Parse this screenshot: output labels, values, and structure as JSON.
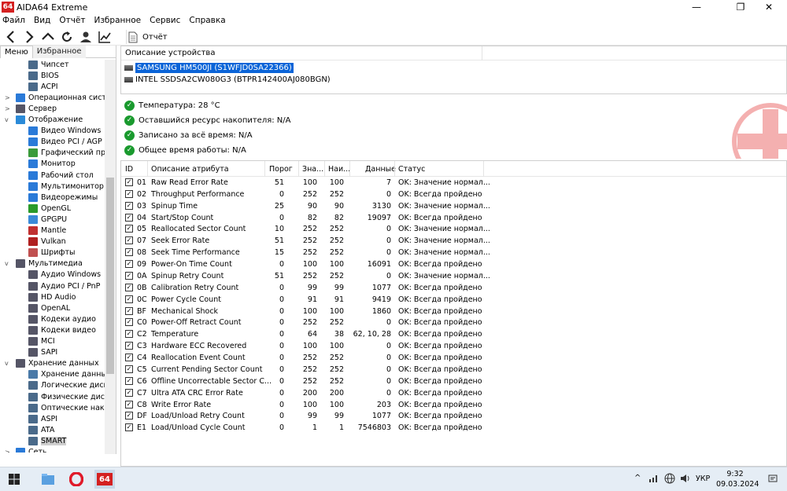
{
  "window": {
    "title": "AIDA64 Extreme",
    "app_badge": "64",
    "minimize": "—",
    "maximize": "❐",
    "close": "✕"
  },
  "menu": [
    "Файл",
    "Вид",
    "Отчёт",
    "Избранное",
    "Сервис",
    "Справка"
  ],
  "toolbar": {
    "report_label": "Отчёт"
  },
  "left_tabs": {
    "menu": "Меню",
    "favorites": "Избранное"
  },
  "tree": [
    {
      "label": "Чипсет",
      "level": 2,
      "color": "#4a6a8a"
    },
    {
      "label": "BIOS",
      "level": 2,
      "color": "#4a6a8a"
    },
    {
      "label": "ACPI",
      "level": 2,
      "color": "#4a6a8a"
    },
    {
      "label": "Операционная систем",
      "level": 1,
      "color": "#2a7ad8",
      "exp": ">"
    },
    {
      "label": "Сервер",
      "level": 1,
      "color": "#556",
      "exp": ">"
    },
    {
      "label": "Отображение",
      "level": 1,
      "color": "#2a8ad8",
      "exp": "v"
    },
    {
      "label": "Видео Windows",
      "level": 2,
      "color": "#2a7ad8"
    },
    {
      "label": "Видео PCI / AGP",
      "level": 2,
      "color": "#2a7ad8"
    },
    {
      "label": "Графический проц",
      "level": 2,
      "color": "#3a9a3a"
    },
    {
      "label": "Монитор",
      "level": 2,
      "color": "#2a7ad8"
    },
    {
      "label": "Рабочий стол",
      "level": 2,
      "color": "#2a7ad8"
    },
    {
      "label": "Мультимонитор",
      "level": 2,
      "color": "#2a7ad8"
    },
    {
      "label": "Видеорежимы",
      "level": 2,
      "color": "#2a7ad8"
    },
    {
      "label": "OpenGL",
      "level": 2,
      "color": "#2a9a2a"
    },
    {
      "label": "GPGPU",
      "level": 2,
      "color": "#3a8ad8"
    },
    {
      "label": "Mantle",
      "level": 2,
      "color": "#c03030"
    },
    {
      "label": "Vulkan",
      "level": 2,
      "color": "#b02020"
    },
    {
      "label": "Шрифты",
      "level": 2,
      "color": "#c05050"
    },
    {
      "label": "Мультимедиа",
      "level": 1,
      "color": "#556",
      "exp": "v"
    },
    {
      "label": "Аудио Windows",
      "level": 2,
      "color": "#556"
    },
    {
      "label": "Аудио PCI / PnP",
      "level": 2,
      "color": "#556"
    },
    {
      "label": "HD Audio",
      "level": 2,
      "color": "#556"
    },
    {
      "label": "OpenAL",
      "level": 2,
      "color": "#556"
    },
    {
      "label": "Кодеки аудио",
      "level": 2,
      "color": "#556"
    },
    {
      "label": "Кодеки видео",
      "level": 2,
      "color": "#556"
    },
    {
      "label": "MCI",
      "level": 2,
      "color": "#556"
    },
    {
      "label": "SAPI",
      "level": 2,
      "color": "#556"
    },
    {
      "label": "Хранение данных",
      "level": 1,
      "color": "#556",
      "exp": "v"
    },
    {
      "label": "Хранение данных W",
      "level": 2,
      "color": "#4a7aa8"
    },
    {
      "label": "Логические диски",
      "level": 2,
      "color": "#4a6a8a"
    },
    {
      "label": "Физические диски",
      "level": 2,
      "color": "#4a6a8a"
    },
    {
      "label": "Оптические накопи",
      "level": 2,
      "color": "#4a6a8a"
    },
    {
      "label": "ASPI",
      "level": 2,
      "color": "#4a6a8a"
    },
    {
      "label": "ATA",
      "level": 2,
      "color": "#4a6a8a"
    },
    {
      "label": "SMART",
      "level": 2,
      "color": "#4a6a8a",
      "selected": true
    },
    {
      "label": "Сеть",
      "level": 1,
      "color": "#2a7ad8",
      "exp": ">"
    }
  ],
  "devices": {
    "header": "Описание устройства",
    "items": [
      {
        "label": "SAMSUNG HM500JI (S1WFJD0SA22366)",
        "selected": true
      },
      {
        "label": "INTEL SSDSA2CW080G3 (BTPR142400AJ080BGN)",
        "selected": false
      }
    ]
  },
  "info": [
    "Температура: 28 °C",
    "Оставшийся ресурс накопителя: N/A",
    "Записано за всё время: N/A",
    "Общее время работы: N/A"
  ],
  "grid": {
    "headers": {
      "id": "ID",
      "desc": "Описание атрибута",
      "threshold": "Порог",
      "value": "Зна...",
      "worst": "Наи...",
      "data": "Данные",
      "status": "Статус"
    },
    "rows": [
      [
        "01",
        "Raw Read Error Rate",
        "51",
        "100",
        "100",
        "7",
        "OK: Значение нормал..."
      ],
      [
        "02",
        "Throughput Performance",
        "0",
        "252",
        "252",
        "0",
        "OK: Всегда пройдено"
      ],
      [
        "03",
        "Spinup Time",
        "25",
        "90",
        "90",
        "3130",
        "OK: Значение нормал..."
      ],
      [
        "04",
        "Start/Stop Count",
        "0",
        "82",
        "82",
        "19097",
        "OK: Всегда пройдено"
      ],
      [
        "05",
        "Reallocated Sector Count",
        "10",
        "252",
        "252",
        "0",
        "OK: Значение нормал..."
      ],
      [
        "07",
        "Seek Error Rate",
        "51",
        "252",
        "252",
        "0",
        "OK: Значение нормал..."
      ],
      [
        "08",
        "Seek Time Performance",
        "15",
        "252",
        "252",
        "0",
        "OK: Значение нормал..."
      ],
      [
        "09",
        "Power-On Time Count",
        "0",
        "100",
        "100",
        "16091",
        "OK: Всегда пройдено"
      ],
      [
        "0A",
        "Spinup Retry Count",
        "51",
        "252",
        "252",
        "0",
        "OK: Значение нормал..."
      ],
      [
        "0B",
        "Calibration Retry Count",
        "0",
        "99",
        "99",
        "1077",
        "OK: Всегда пройдено"
      ],
      [
        "0C",
        "Power Cycle Count",
        "0",
        "91",
        "91",
        "9419",
        "OK: Всегда пройдено"
      ],
      [
        "BF",
        "Mechanical Shock",
        "0",
        "100",
        "100",
        "1860",
        "OK: Всегда пройдено"
      ],
      [
        "C0",
        "Power-Off Retract Count",
        "0",
        "252",
        "252",
        "0",
        "OK: Всегда пройдено"
      ],
      [
        "C2",
        "Temperature",
        "0",
        "64",
        "38",
        "62, 10, 28",
        "OK: Всегда пройдено"
      ],
      [
        "C3",
        "Hardware ECC Recovered",
        "0",
        "100",
        "100",
        "0",
        "OK: Всегда пройдено"
      ],
      [
        "C4",
        "Reallocation Event Count",
        "0",
        "252",
        "252",
        "0",
        "OK: Всегда пройдено"
      ],
      [
        "C5",
        "Current Pending Sector Count",
        "0",
        "252",
        "252",
        "0",
        "OK: Всегда пройдено"
      ],
      [
        "C6",
        "Offline Uncorrectable Sector C...",
        "0",
        "252",
        "252",
        "0",
        "OK: Всегда пройдено"
      ],
      [
        "C7",
        "Ultra ATA CRC Error Rate",
        "0",
        "200",
        "200",
        "0",
        "OK: Всегда пройдено"
      ],
      [
        "C8",
        "Write Error Rate",
        "0",
        "100",
        "100",
        "203",
        "OK: Всегда пройдено"
      ],
      [
        "DF",
        "Load/Unload Retry Count",
        "0",
        "99",
        "99",
        "1077",
        "OK: Всегда пройдено"
      ],
      [
        "E1",
        "Load/Unload Cycle Count",
        "0",
        "1",
        "1",
        "7546803",
        "OK: Всегда пройдено"
      ]
    ]
  },
  "taskbar": {
    "aida_badge": "64",
    "lang": "УКР",
    "time": "9:32",
    "date": "09.03.2024",
    "chevron": "^"
  }
}
